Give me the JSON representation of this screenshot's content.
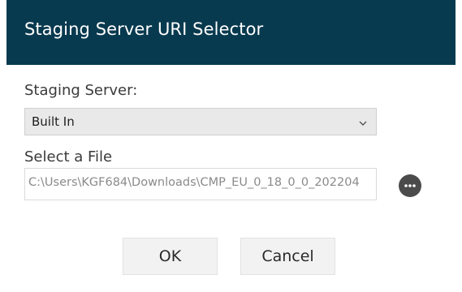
{
  "dialog": {
    "title": "Staging Server URI Selector"
  },
  "staging_server": {
    "label": "Staging Server:",
    "selected": "Built In",
    "icon": "chevron-down-icon"
  },
  "file": {
    "label": "Select a File",
    "value": "C:\\Users\\KGF684\\Downloads\\CMP_EU_0_18_0_0_202204",
    "browse_icon": "ellipsis-icon"
  },
  "buttons": {
    "ok": "OK",
    "cancel": "Cancel"
  },
  "colors": {
    "titlebar": "#083a4f",
    "browse_button": "#4b4b4b"
  }
}
